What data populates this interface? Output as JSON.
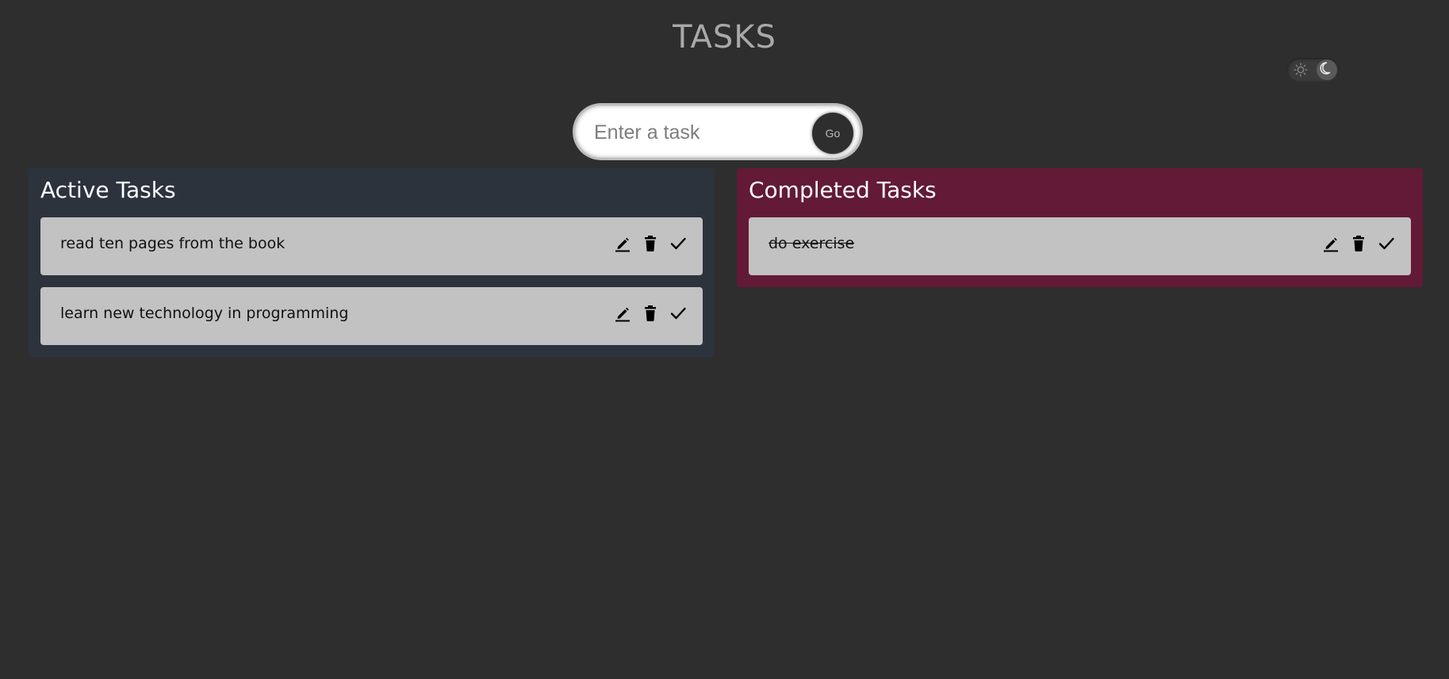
{
  "header": {
    "title": "TASKS"
  },
  "theme_toggle": {
    "light_icon": "sun-icon",
    "dark_icon": "moon-icon",
    "selected": "dark"
  },
  "task_form": {
    "placeholder": "Enter a task",
    "value": "",
    "submit_label": "Go"
  },
  "active_panel": {
    "heading": "Active Tasks",
    "tasks": [
      {
        "text": "read ten pages from the book"
      },
      {
        "text": "learn new technology in programming"
      }
    ]
  },
  "completed_panel": {
    "heading": "Completed Tasks",
    "tasks": [
      {
        "text": "do exercise"
      }
    ]
  },
  "task_actions": {
    "edit_icon": "pencil-icon",
    "delete_icon": "trash-icon",
    "done_icon": "check-icon"
  },
  "colors": {
    "background": "#2e2e2e",
    "active_panel": "#2d333d",
    "completed_panel": "#621a36",
    "task_card": "#c2c2c2"
  }
}
